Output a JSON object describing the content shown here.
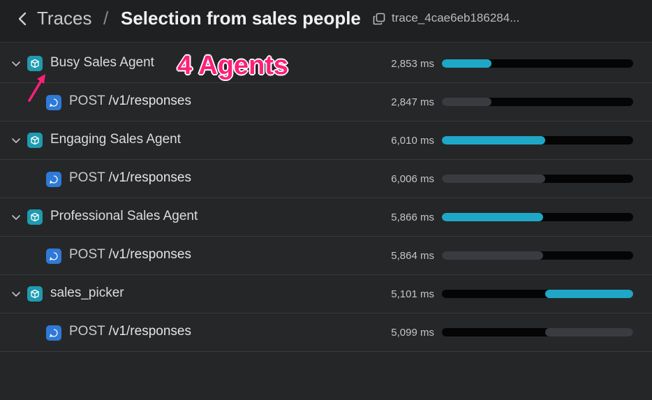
{
  "header": {
    "back_icon": "chevron-left-icon",
    "root_label": "Traces",
    "separator": "/",
    "title": "Selection from sales people",
    "copy_icon": "copy-icon",
    "trace_id": "trace_4cae6eb186284..."
  },
  "annotation": {
    "text": "4 Agents",
    "color": "#ff1f78"
  },
  "rows": [
    {
      "type": "agent",
      "label": "Busy Sales Agent",
      "duration": "2,853 ms",
      "bar_start": 0.0,
      "bar_fraction": 0.26
    },
    {
      "type": "response",
      "method": "POST",
      "path": "/v1/responses",
      "duration": "2,847 ms",
      "bar_start": 0.0,
      "bar_fraction": 0.26
    },
    {
      "type": "agent",
      "label": "Engaging Sales Agent",
      "duration": "6,010 ms",
      "bar_start": 0.0,
      "bar_fraction": 0.54
    },
    {
      "type": "response",
      "method": "POST",
      "path": "/v1/responses",
      "duration": "6,006 ms",
      "bar_start": 0.0,
      "bar_fraction": 0.54
    },
    {
      "type": "agent",
      "label": "Professional Sales Agent",
      "duration": "5,866 ms",
      "bar_start": 0.0,
      "bar_fraction": 0.53
    },
    {
      "type": "response",
      "method": "POST",
      "path": "/v1/responses",
      "duration": "5,864 ms",
      "bar_start": 0.0,
      "bar_fraction": 0.53
    },
    {
      "type": "agent",
      "label": "sales_picker",
      "duration": "5,101 ms",
      "bar_start": 0.54,
      "bar_fraction": 0.46
    },
    {
      "type": "response",
      "method": "POST",
      "path": "/v1/responses",
      "duration": "5,099 ms",
      "bar_start": 0.54,
      "bar_fraction": 0.46
    }
  ],
  "colors": {
    "agent_icon": "#1e9bb0",
    "response_icon": "#2f7ad8",
    "agent_bar": "#1ea7c6",
    "response_bar": "#393b40",
    "track": "#050505"
  }
}
